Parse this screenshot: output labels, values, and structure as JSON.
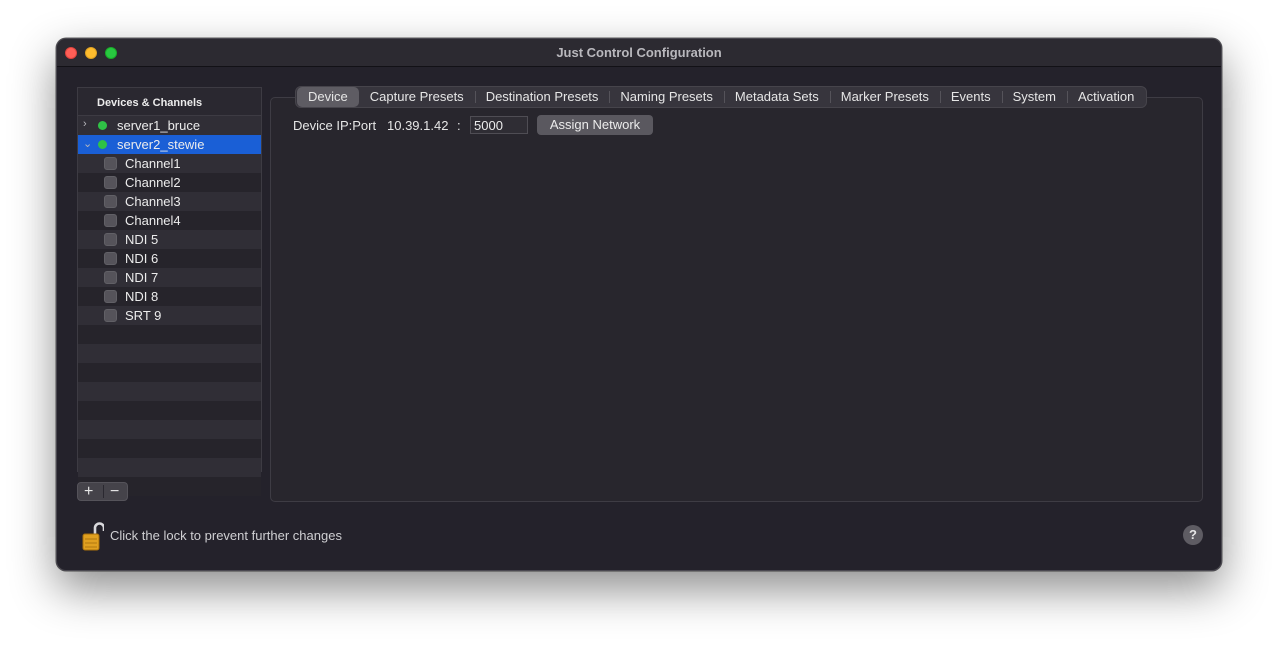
{
  "window": {
    "title": "Just Control Configuration"
  },
  "sidebar": {
    "header": "Devices & Channels",
    "servers": [
      {
        "label": "server1_bruce",
        "expanded": false,
        "status_color": "#2fc246"
      },
      {
        "label": "server2_stewie",
        "expanded": true,
        "status_color": "#2fc246"
      }
    ],
    "channels": [
      "Channel1",
      "Channel2",
      "Channel3",
      "Channel4",
      "NDI 5",
      "NDI 6",
      "NDI 7",
      "NDI 8",
      "SRT 9"
    ],
    "add_label": "+",
    "remove_label": "−",
    "selection_color": "#1a5fd6"
  },
  "tabs": [
    "Device",
    "Capture Presets",
    "Destination Presets",
    "Naming Presets",
    "Metadata Sets",
    "Marker Presets",
    "Events",
    "System",
    "Activation"
  ],
  "device": {
    "ip_label": "Device IP:Port",
    "ip_value": "10.39.1.42",
    "colon": ":",
    "port_value": "5000",
    "assign_label": "Assign Network"
  },
  "footer": {
    "lock_text": "Click the lock to prevent further changes",
    "help_label": "?"
  }
}
